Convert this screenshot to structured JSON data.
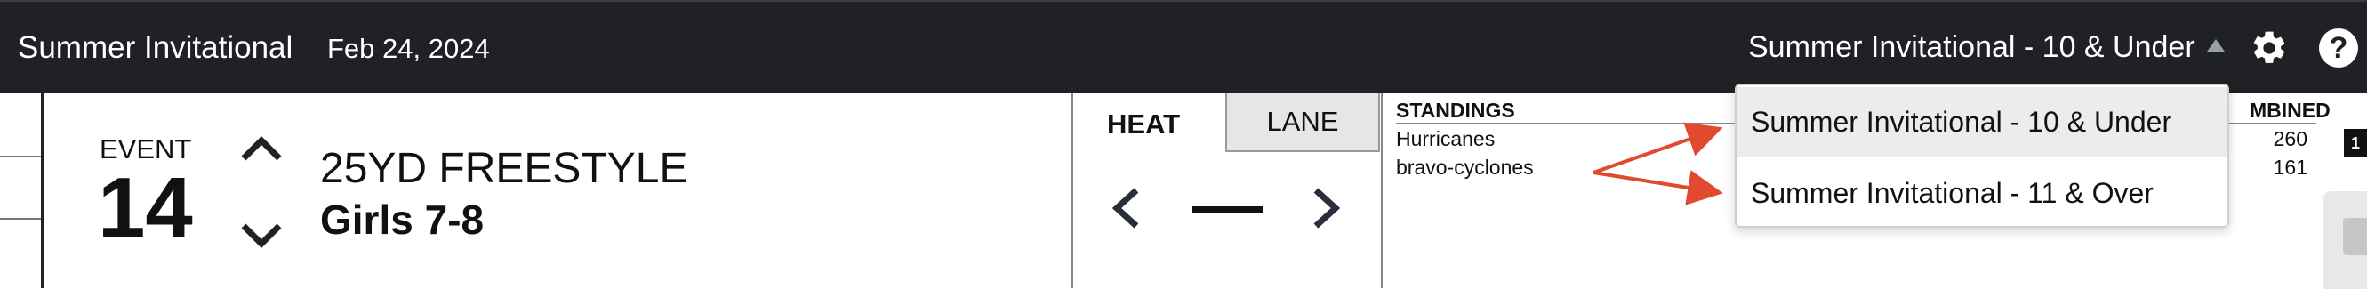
{
  "header": {
    "app_title": "Summer Invitational",
    "date": "Feb 24, 2024",
    "meet_select_value": "Summer Invitational - 10 & Under",
    "settings_icon": "gear-icon",
    "help_icon": "help-icon",
    "help_glyph": "?"
  },
  "event": {
    "label": "EVENT",
    "number": "14",
    "name": "25YD FREESTYLE",
    "group": "Girls 7-8"
  },
  "heat_panel": {
    "tabs": [
      {
        "label": "HEAT",
        "active": true
      },
      {
        "label": "LANE",
        "active": false
      }
    ]
  },
  "standings": {
    "title": "STANDINGS",
    "combined_label": "MBINED",
    "teams": [
      {
        "name": "Hurricanes",
        "score": "260"
      },
      {
        "name": "bravo-cyclones",
        "score": "161"
      }
    ]
  },
  "dropdown": {
    "options": [
      {
        "label": "Summer Invitational - 10 & Under",
        "selected": true
      },
      {
        "label": "Summer Invitational - 11 & Over",
        "selected": false
      }
    ]
  },
  "side": {
    "badge": "1"
  },
  "colors": {
    "topbar": "#1f2125",
    "annotation_arrow": "#e04a2f",
    "dropdown_selected": "#ececec",
    "lane_tab": "#e6e6e6"
  }
}
